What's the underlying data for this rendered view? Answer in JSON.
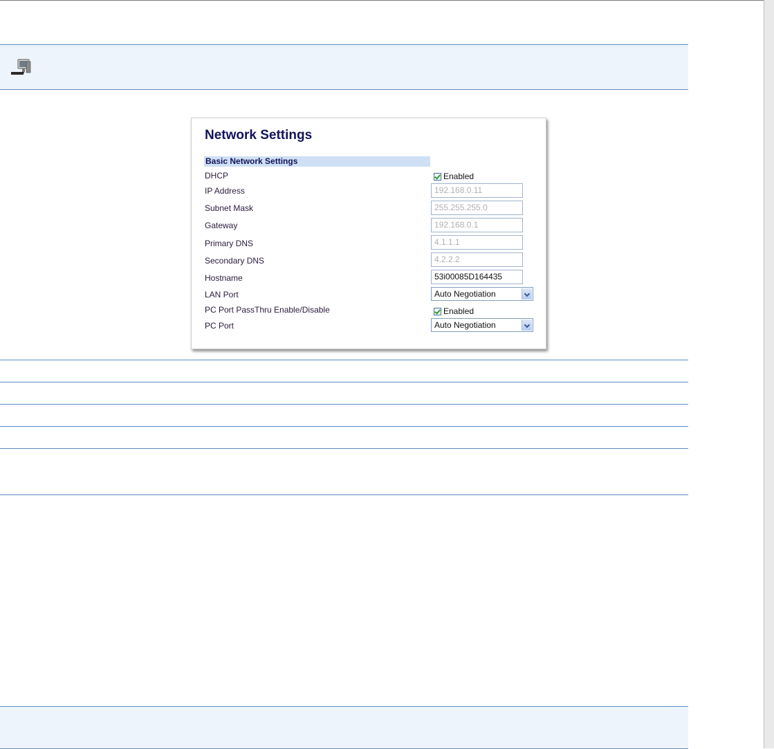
{
  "panel": {
    "title": "Network Settings",
    "section": "Basic Network Settings",
    "fields": {
      "dhcp": {
        "label": "DHCP",
        "checkbox_label": "Enabled",
        "checked": true
      },
      "ip": {
        "label": "IP Address",
        "value": "192.168.0.11"
      },
      "subnet": {
        "label": "Subnet Mask",
        "value": "255.255.255.0"
      },
      "gateway": {
        "label": "Gateway",
        "value": "192.168.0.1"
      },
      "primary_dns": {
        "label": "Primary DNS",
        "value": "4.1.1.1"
      },
      "secondary_dns": {
        "label": "Secondary DNS",
        "value": "4.2.2.2"
      },
      "hostname": {
        "label": "Hostname",
        "value": "53i00085D164435"
      },
      "lan_port": {
        "label": "LAN Port",
        "selected": "Auto Negotiation"
      },
      "pc_passthru": {
        "label": "PC Port PassThru Enable/Disable",
        "checkbox_label": "Enabled",
        "checked": true
      },
      "pc_port": {
        "label": "PC Port",
        "selected": "Auto Negotiation"
      }
    }
  },
  "icons": {
    "note": "computer-note-icon"
  },
  "colors": {
    "rule": "#5b8cc2",
    "band": "#eef4fb",
    "title": "#12125a",
    "section": "#cfe0f5"
  }
}
